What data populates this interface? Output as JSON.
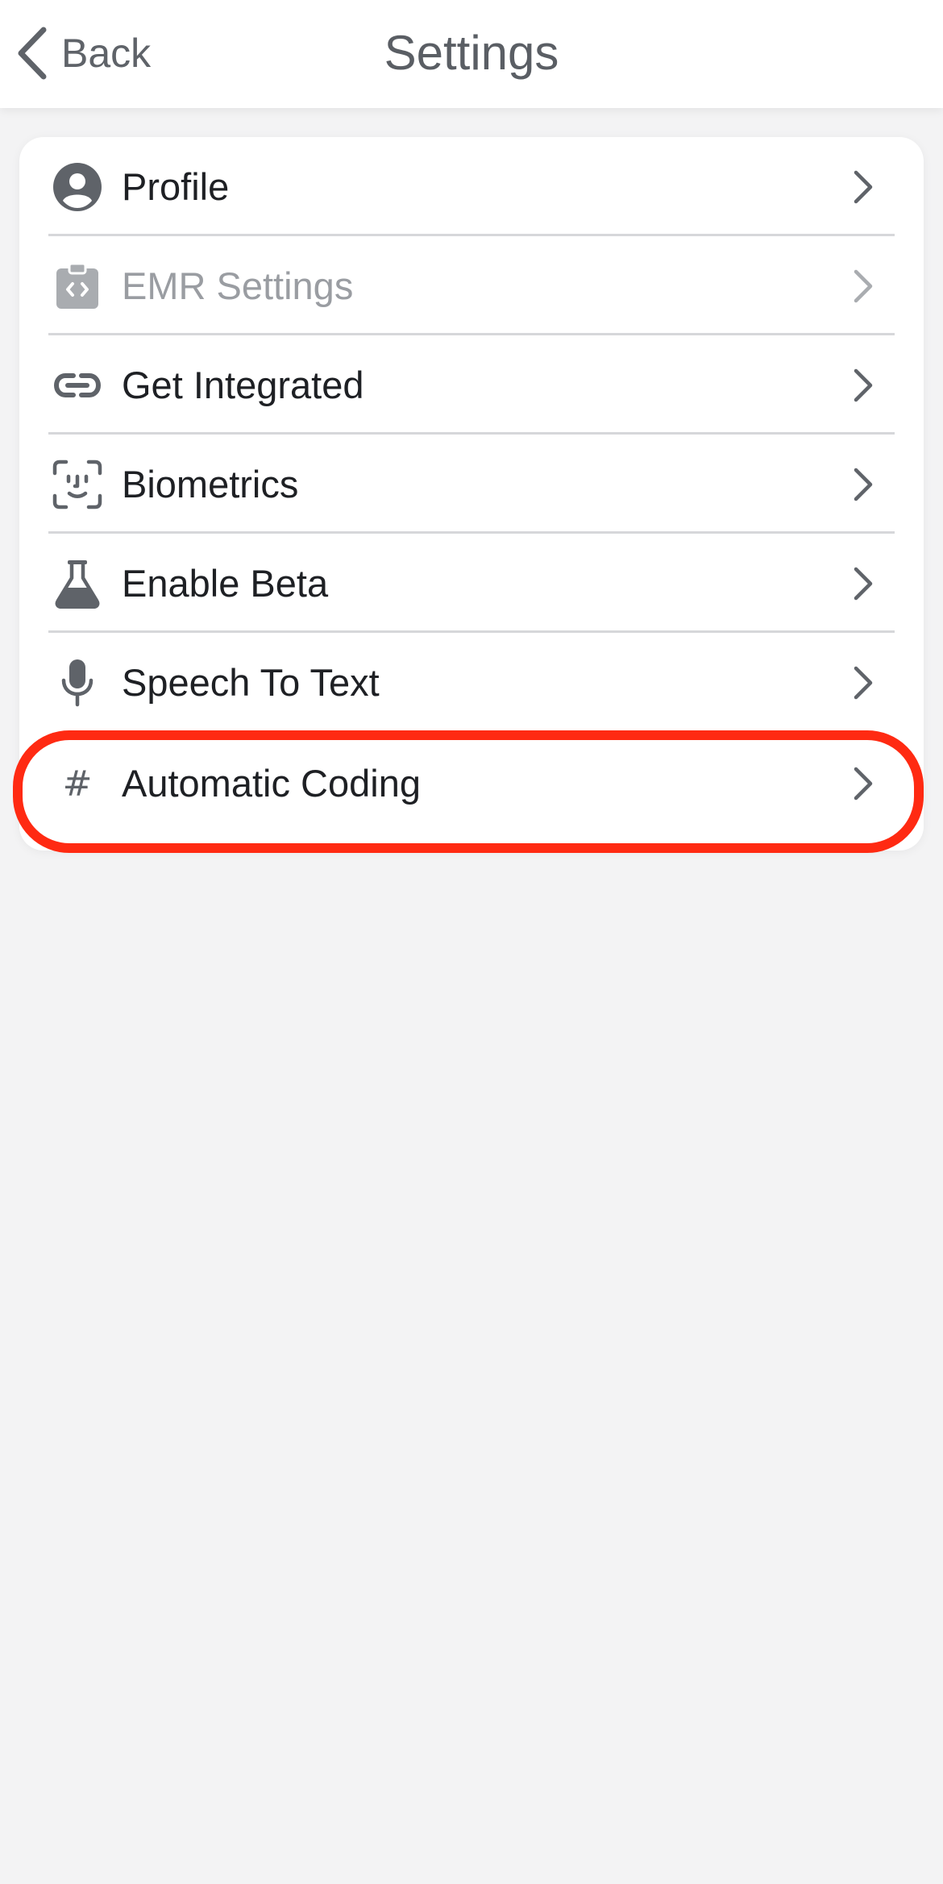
{
  "nav": {
    "back_label": "Back",
    "title": "Settings"
  },
  "settings": {
    "items": [
      {
        "label": "Profile",
        "icon": "profile-icon",
        "enabled": true
      },
      {
        "label": "EMR Settings",
        "icon": "emr-clipboard-icon",
        "enabled": false
      },
      {
        "label": "Get Integrated",
        "icon": "link-icon",
        "enabled": true
      },
      {
        "label": "Biometrics",
        "icon": "face-id-icon",
        "enabled": true
      },
      {
        "label": "Enable Beta",
        "icon": "flask-icon",
        "enabled": true
      },
      {
        "label": "Speech To Text",
        "icon": "microphone-icon",
        "enabled": true
      },
      {
        "label": "Automatic Coding",
        "icon": "hashtag-icon",
        "enabled": true,
        "highlighted": true
      }
    ]
  },
  "colors": {
    "icon_gray": "#5f6369",
    "disabled_gray": "#a9acb0",
    "highlight": "#ff2a12",
    "background": "#f3f3f4",
    "text": "#1e2024"
  }
}
